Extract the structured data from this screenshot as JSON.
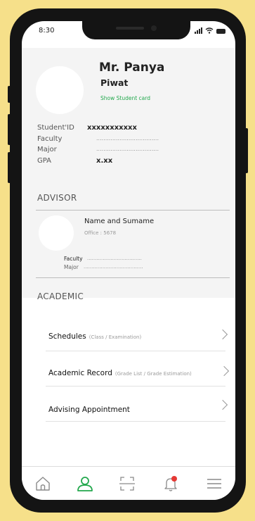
{
  "status_bar": {
    "time": "8:30"
  },
  "profile": {
    "first_name": "Mr. Panya",
    "last_name": "Piwat",
    "student_card_link": "Show Student card",
    "student_id_label": "Student'ID",
    "student_id_value": "xxxxxxxxxxx",
    "faculty_label": "Faculty",
    "faculty_value": "...................................",
    "major_label": "Major",
    "major_value": "...................................",
    "gpa_label": "GPA",
    "gpa_value": "x.xx"
  },
  "advisor": {
    "section_title": "ADVISOR",
    "name": "Name and Sumame",
    "office": "Office : 5678",
    "faculty_label": "Faculty",
    "faculty_value": "...................................",
    "major_label": "Major",
    "major_value": "......................................"
  },
  "academic": {
    "section_title": "ACADEMIC",
    "items": [
      {
        "label": "Schedules",
        "sub": "(Class / Examination)"
      },
      {
        "label": "Academic Record",
        "sub": "(Grade List / Grade Estimation)"
      },
      {
        "label": "Advising Appointment",
        "sub": ""
      }
    ]
  },
  "tabbar": {
    "items": [
      "home-icon",
      "profile-icon",
      "scan-icon",
      "notification-icon",
      "menu-icon"
    ],
    "accent": "#23a84d",
    "badge_color": "#e53935"
  }
}
